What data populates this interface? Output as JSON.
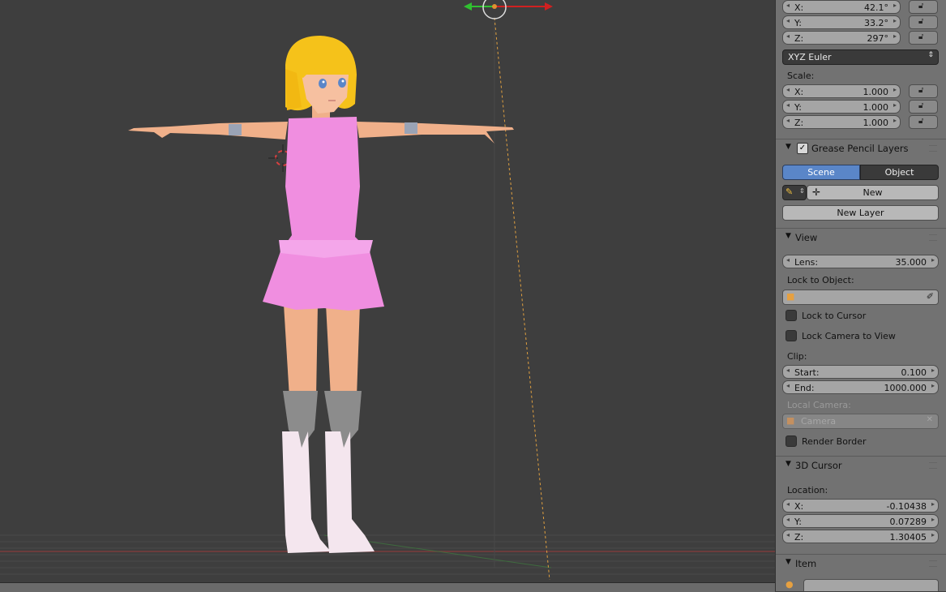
{
  "rotation": [
    {
      "label": "X:",
      "value": "42.1°"
    },
    {
      "label": "Y:",
      "value": "33.2°"
    },
    {
      "label": "Z:",
      "value": "297°"
    }
  ],
  "rotation_mode": "XYZ Euler",
  "scale": {
    "title": "Scale:",
    "items": [
      {
        "label": "X:",
        "value": "1.000"
      },
      {
        "label": "Y:",
        "value": "1.000"
      },
      {
        "label": "Z:",
        "value": "1.000"
      }
    ]
  },
  "grease_pencil": {
    "title": "Grease Pencil Layers",
    "tab_scene": "Scene",
    "tab_object": "Object",
    "new_label": "New",
    "new_layer_label": "New Layer"
  },
  "view": {
    "title": "View",
    "lens_label": "Lens:",
    "lens_value": "35.000",
    "lock_to_object": "Lock to Object:",
    "lock_to_cursor": "Lock to Cursor",
    "lock_camera_to_view": "Lock Camera to View",
    "clip": "Clip:",
    "start_label": "Start:",
    "start_value": "0.100",
    "end_label": "End:",
    "end_value": "1000.000",
    "local_camera": "Local Camera:",
    "camera_placeholder": "Camera",
    "render_border": "Render Border"
  },
  "cursor": {
    "title": "3D Cursor",
    "location": "Location:",
    "items": [
      {
        "label": "X:",
        "value": "-0.10438"
      },
      {
        "label": "Y:",
        "value": "0.07289"
      },
      {
        "label": "Z:",
        "value": "1.30405"
      }
    ]
  },
  "item": {
    "title": "Item"
  },
  "colors": {
    "dress": "#f08ee0",
    "hair": "#f5c21a",
    "skin": "#f0b08a",
    "boots": "#f4e6ee",
    "accent_blue": "#5a86c8"
  }
}
